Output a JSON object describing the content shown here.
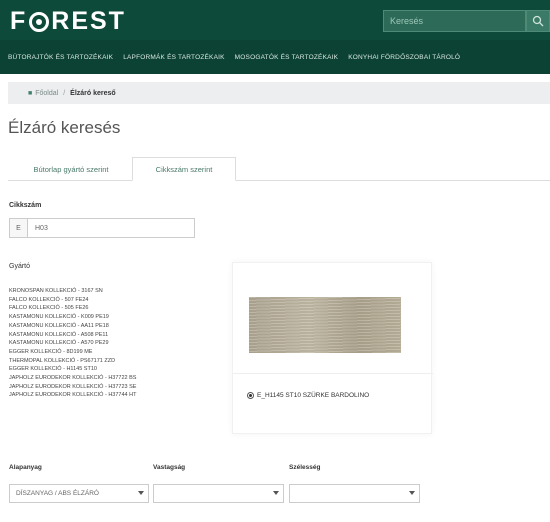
{
  "header": {
    "logo_text_1": "F",
    "logo_text_2": "REST",
    "search_placeholder": "Keresés"
  },
  "nav": {
    "items": [
      "BÚTORAJTÓK ÉS TARTOZÉKAIK",
      "LAPFORMÁK ÉS TARTOZÉKAIK",
      "MOSOGATÓK ÉS TARTOZÉKAIK",
      "KONYHAI FÖRDŐSZOBAI TÁROLÓ"
    ]
  },
  "breadcrumb": {
    "home": "Főoldal",
    "current": "Élzáró kereső"
  },
  "page": {
    "title": "Élzáró keresés"
  },
  "tabs": [
    {
      "label": "Bútorlap gyártó szerint"
    },
    {
      "label": "Cikkszám szerint"
    }
  ],
  "cikkszam": {
    "label": "Cikkszám",
    "prefix": "E",
    "value": "H03"
  },
  "gyarto": {
    "label": "Gyártó",
    "items": [
      "KRONOSPAN KOLLEKCIÓ - 3167 SN",
      "FALCO KOLLEKCIÓ - 507 FE24",
      "FALCO KOLLEKCIÓ - 505 FE26",
      "KASTAMONU KOLLEKCIÓ - K009 PE19",
      "KASTAMONU KOLLEKCIÓ - AA11 PE18",
      "KASTAMONU KOLLEKCIÓ - A508 PE11",
      "KASTAMONU KOLLEKCIÓ - A570 PE29",
      "EGGER KOLLEKCIÓ - 8D199 ME",
      "THERMOPAL KOLLEKCIÓ - PS67171 ZZD",
      "EGGER KOLLEKCIÓ - H1145 ST10",
      "JAPHOLZ EURODEKOR KOLLEKCIÓ - H37722 BS",
      "JAPHOLZ EURODEKOR KOLLEKCIÓ - H37723 SE",
      "JAPHOLZ EURODEKOR KOLLEKCIÓ - H37744 HT"
    ]
  },
  "preview": {
    "caption": "E_H1145 ST10 SZÜRKE BARDOLINO"
  },
  "filters": {
    "alapanyag_label": "Alapanyag",
    "alapanyag_value": "DÍSZANYAG / ABS ÉLZÁRÓ",
    "vastagsag_label": "Vastagság",
    "vastagsag_value": "",
    "szelesseg_label": "Szélesség",
    "szelesseg_value": ""
  },
  "colors": {
    "header_bg": "#0e4a3a",
    "nav_bg": "#0c4234",
    "accent": "#3f7f6b"
  }
}
